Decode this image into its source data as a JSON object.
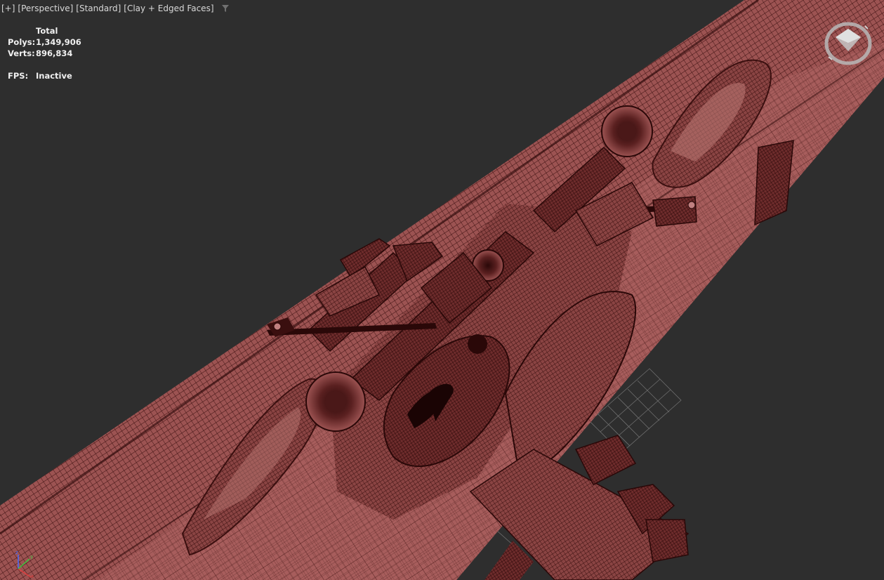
{
  "viewport": {
    "labels": [
      "[+]",
      "[Perspective]",
      "[Standard]",
      "[Clay + Edged Faces]"
    ],
    "filter_icon": "filter-funnel-icon"
  },
  "stats": {
    "header": "Total",
    "polys_label": "Polys:",
    "polys_value": "1,349,906",
    "verts_label": "Verts:",
    "verts_value": "896,834",
    "fps_label": "FPS:",
    "fps_value": "Inactive"
  },
  "scene": {
    "model_color": "#9c5352",
    "wire_color": "#3a0f0f",
    "grid_color": "#8a8a8a",
    "background": "#2e2e2e"
  },
  "navigation": {
    "viewcube_icon": "viewcube-icon",
    "axis_icon": "axis-tripod-icon"
  }
}
